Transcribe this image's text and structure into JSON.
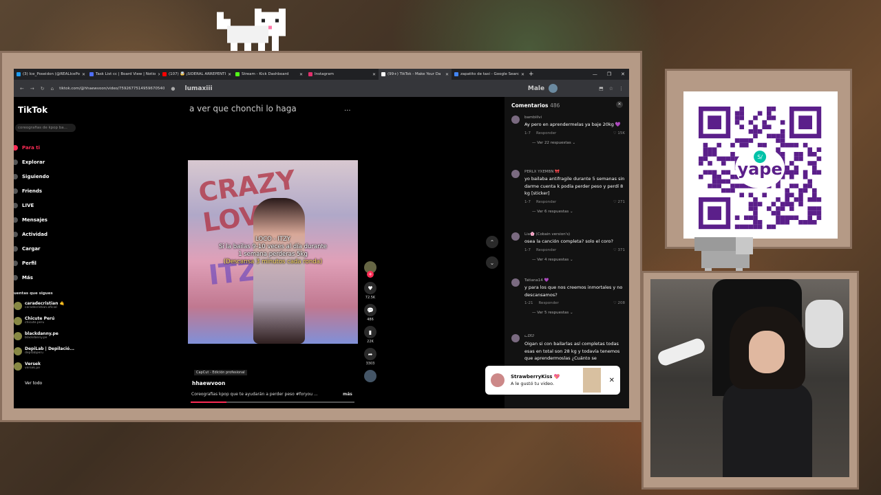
{
  "browser": {
    "tabs": [
      {
        "title": "(3) Ice_Poseidon (@REALIcePo",
        "color": "#1d9bf0"
      },
      {
        "title": "Task List cc | Board View | Notio",
        "color": "#4f6ef7"
      },
      {
        "title": "(107) 🤯 ¡SIDERAL ARREPENTI",
        "color": "#ff0000"
      },
      {
        "title": "Stream - Kick Dashboard",
        "color": "#53fc18"
      },
      {
        "title": "Instagram",
        "color": "#e1306c"
      },
      {
        "title": "(99+) TikTok - Make Your Da",
        "color": "#ffffff"
      },
      {
        "title": "zapatito de taxi - Google Searc",
        "color": "#4285f4"
      }
    ],
    "url": "tiktok.com/@hhaewvoon/video/7592677514959670540",
    "url_user": "lumaxiii",
    "url_user_right": "Male"
  },
  "tiktok": {
    "logo": "TikTok",
    "search_placeholder": "coreografias de kpop ba...",
    "nav": [
      "Para ti",
      "Explorar",
      "Siguiendo",
      "Friends",
      "LIVE",
      "Mensajes",
      "Actividad",
      "Cargar",
      "Perfil",
      "Más"
    ],
    "following_title": "uentas que sigues",
    "accounts": [
      {
        "name": "caradecristian 🤙",
        "handle": "caradecristian.oficial"
      },
      {
        "name": "Chicute Perú",
        "handle": "chicute.peru"
      },
      {
        "name": "blackdanny.pe",
        "handle": "blackdanny.pe"
      },
      {
        "name": "DepiLab | Depilació...",
        "handle": "depilabperu"
      },
      {
        "name": "Versek",
        "handle": "versek.pe"
      }
    ],
    "see_all": "Ver todo"
  },
  "video": {
    "chat_title": "a ver que chonchi lo haga",
    "dots": "...",
    "banner_text_1": "CRAZY LOVE",
    "banner_text_2": "ITZY",
    "caption_lines": [
      "LOCO - ITZY",
      "Si la bailas 9-10 veces al día durante",
      "1 semana perderas 5kg"
    ],
    "caption_note": "(Descansa 3 minutos cada ronda)",
    "likes": "72.5K",
    "comments": "486",
    "saves": "22K",
    "shares": "3303",
    "capcut": "CapCut - Edición profesional",
    "author": "hhaewvoon",
    "description": "Coreografias kpop que te ayudarán a perder peso #foryou ...",
    "more": "más",
    "progress": 0.22
  },
  "comments": {
    "title": "Comentarios",
    "count": "486",
    "items": [
      {
        "user": "bambiilvi",
        "text": "Ay pero en aprendermelas ya baje 20kg 💜",
        "date": "1-7",
        "reply": "Responder",
        "likes": "15K",
        "more": "Ver 22 respuestas"
      },
      {
        "user": "PERLX YXEMBN 🎀",
        "text": "yo bailaba antifragile durante 5 semanas sin darme cuenta k podía perder peso y perdí 8 kg [sticker]",
        "date": "1-7",
        "reply": "Responder",
        "likes": "271",
        "more": "Ver 6 respuestas"
      },
      {
        "user": "Lia🌸 (Cobain version's)",
        "text": "osea la canción completa? solo el coro?",
        "date": "1-7",
        "reply": "Responder",
        "likes": "371",
        "more": "Ver 4 respuestas"
      },
      {
        "user": "Tatiana14 💜",
        "text": "y para los que nos creemos inmortales y no descansamos?",
        "date": "1-21",
        "reply": "Responder",
        "likes": "208",
        "more": "Ver 5 respuestas"
      },
      {
        "user": "ᓚᘏᗢ",
        "text": "Oigan si con bailarlas así completas todas esas en total son 28 kg y todavía tenemos que aprendermoslas ¿Cuánto se",
        "date": "",
        "reply": "",
        "likes": "",
        "more": ""
      }
    ]
  },
  "notification": {
    "user": "StrawberryKiss 💖",
    "text": "A le gustó tu video."
  },
  "qr": {
    "brand": "yape",
    "badge": "S/"
  }
}
